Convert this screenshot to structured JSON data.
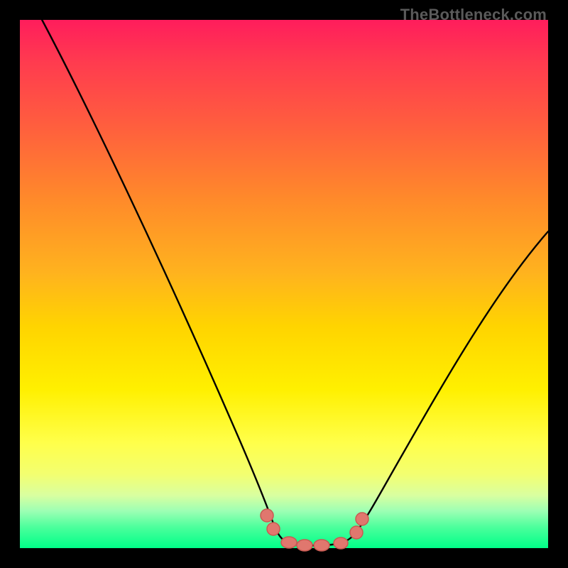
{
  "watermark": "TheBottleneck.com",
  "chart_data": {
    "type": "line",
    "title": "",
    "xlabel": "",
    "ylabel": "",
    "x": [
      0.0,
      0.05,
      0.1,
      0.15,
      0.2,
      0.25,
      0.3,
      0.35,
      0.4,
      0.45,
      0.48,
      0.5,
      0.55,
      0.6,
      0.63,
      0.65,
      0.7,
      0.75,
      0.8,
      0.85,
      0.9,
      0.95,
      1.0
    ],
    "y": [
      1.0,
      0.91,
      0.81,
      0.71,
      0.61,
      0.51,
      0.41,
      0.31,
      0.21,
      0.1,
      0.04,
      0.01,
      0.0,
      0.0,
      0.01,
      0.03,
      0.09,
      0.17,
      0.25,
      0.34,
      0.42,
      0.51,
      0.6
    ],
    "ylim": [
      0,
      1
    ],
    "xlim": [
      0,
      1
    ],
    "grid": false,
    "markers": [
      {
        "x": 0.47,
        "y": 0.06
      },
      {
        "x": 0.48,
        "y": 0.035
      },
      {
        "x": 0.51,
        "y": 0.01
      },
      {
        "x": 0.54,
        "y": 0.002
      },
      {
        "x": 0.57,
        "y": 0.001
      },
      {
        "x": 0.61,
        "y": 0.005
      },
      {
        "x": 0.64,
        "y": 0.024
      },
      {
        "x": 0.65,
        "y": 0.05
      }
    ],
    "colors": {
      "gradient_top": "#ff1d5c",
      "gradient_mid": "#fff000",
      "gradient_bottom": "#00ff88",
      "curve": "#000000",
      "markers": "#e0776e",
      "frame": "#000000",
      "watermark": "#5a5a5a"
    }
  }
}
